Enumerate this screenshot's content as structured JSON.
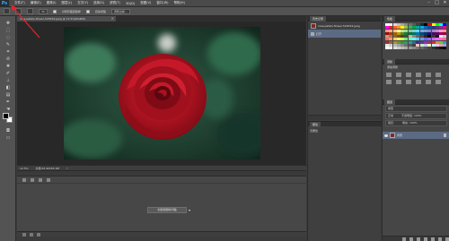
{
  "app": {
    "logo": "Ps"
  },
  "menu": [
    "文件(F)",
    "编辑(E)",
    "图像(I)",
    "图层(L)",
    "文字(Y)",
    "选择(S)",
    "滤镜(T)",
    "3D(D)",
    "视图(V)",
    "窗口(W)",
    "帮助(H)"
  ],
  "window_controls": [
    "–",
    "□",
    "✕"
  ],
  "options_bar": {
    "size_value": "30",
    "sample_label": "对所有图层取样",
    "auto_enhance_label": "自动增强",
    "refine_button": "调整边缘..."
  },
  "document": {
    "tab_title": "rose-petals-flower-526154.jpeg @ 12.5%(RGB/8)",
    "close": "×",
    "zoom": "12.5%",
    "doc_info": "文档:65.9M/65.9M"
  },
  "timeline": {
    "create_button": "创建视频时间轴",
    "dropdown": "▾"
  },
  "history": {
    "tab": "历史记录",
    "items": [
      {
        "label": "rose-petals-flower-526154.jpeg"
      },
      {
        "label": "打开"
      }
    ]
  },
  "properties": {
    "tab": "属性",
    "title": "无属性"
  },
  "swatches": {
    "tab": "色板",
    "colors": [
      "#ffffff",
      "#f2f2f2",
      "#d9d9d9",
      "#bfbfbf",
      "#a6a6a6",
      "#8c8c8c",
      "#737373",
      "#595959",
      "#404040",
      "#262626",
      "#000000",
      "#ff0000",
      "#ffff00",
      "#00ff00",
      "#00ffff",
      "#0000ff",
      "#ff00ff",
      "#ee1c24",
      "#f26522",
      "#f7941d",
      "#fff200",
      "#8dc63f",
      "#39b54a",
      "#00a651",
      "#00a99d",
      "#00aeef",
      "#0072bc",
      "#0054a6",
      "#2e3192",
      "#662d91",
      "#92278f",
      "#ec008c",
      "#f69679",
      "#f9ad81",
      "#fdc689",
      "#fff799",
      "#c4df9b",
      "#a3d39c",
      "#82ca9d",
      "#7bcdc8",
      "#6dcff6",
      "#7da7d9",
      "#8393ca",
      "#8781bd",
      "#a186be",
      "#bd8cbf",
      "#f49ac1",
      "#f5989d",
      "#9e0b0f",
      "#a0410d",
      "#a36209",
      "#aba000",
      "#598527",
      "#197b30",
      "#007236",
      "#00746b",
      "#0076a3",
      "#004b80",
      "#003471",
      "#1b1464",
      "#440e62",
      "#630460",
      "#9e005d",
      "#9e0039",
      "#c69c6d",
      "#a67c52",
      "#8c6239",
      "#754c24",
      "#603913",
      "#534741",
      "#c7b299",
      "#998675",
      "#736357",
      "#534741",
      "#42210b",
      "#000000",
      "#363636",
      "#1a1a1a",
      "#e6e6e6",
      "#cccccc",
      "#ff6666",
      "#ff9966",
      "#ffcc66",
      "#ffff66",
      "#ccff66",
      "#66ff66",
      "#66ffcc",
      "#66ffff",
      "#66ccff",
      "#6699ff",
      "#6666ff",
      "#9966ff",
      "#cc66ff",
      "#ff66ff",
      "#ff66cc",
      "#ff6699",
      "#993333",
      "#996633",
      "#999933",
      "#669933",
      "#339933",
      "#339966",
      "#339999",
      "#336699",
      "#333399",
      "#663399",
      "#993399",
      "#993366",
      "#cc3333",
      "#cc9933",
      "#66cc33",
      "#3399cc",
      "#e8e8e8",
      "#d0d0d0",
      "#b8b8b8",
      "#a0a0a0",
      "#888888",
      "#707070",
      "#585858",
      "#404040",
      "#f0c0c0",
      "#c0f0c0",
      "#c0c0f0",
      "#f0f0c0",
      "#c0f0f0",
      "#f0c0f0",
      "#e0a0a0",
      "#a0a0e0",
      "#ffffff",
      "#eeeeee",
      "#dddddd",
      "#cccccc",
      "#bbbbbb",
      "#aaaaaa",
      "#999999",
      "#888888",
      "#777777",
      "#666666",
      "#555555",
      "#444444",
      "#333333",
      "#222222",
      "#111111",
      "#000000"
    ]
  },
  "adjustments": {
    "tab": "调整",
    "label": "添加调整"
  },
  "layers": {
    "tab": "图层",
    "filter_label": "类型",
    "blend_mode": "正常",
    "opacity": "不透明度: 100%",
    "lock_label": "锁定:",
    "fill": "填充: 100%",
    "items": [
      {
        "name": "背景"
      }
    ]
  },
  "colors": {
    "accent": "#31a8ff",
    "selection": "#5c6b84",
    "annotation_arrow": "#e8232a"
  }
}
